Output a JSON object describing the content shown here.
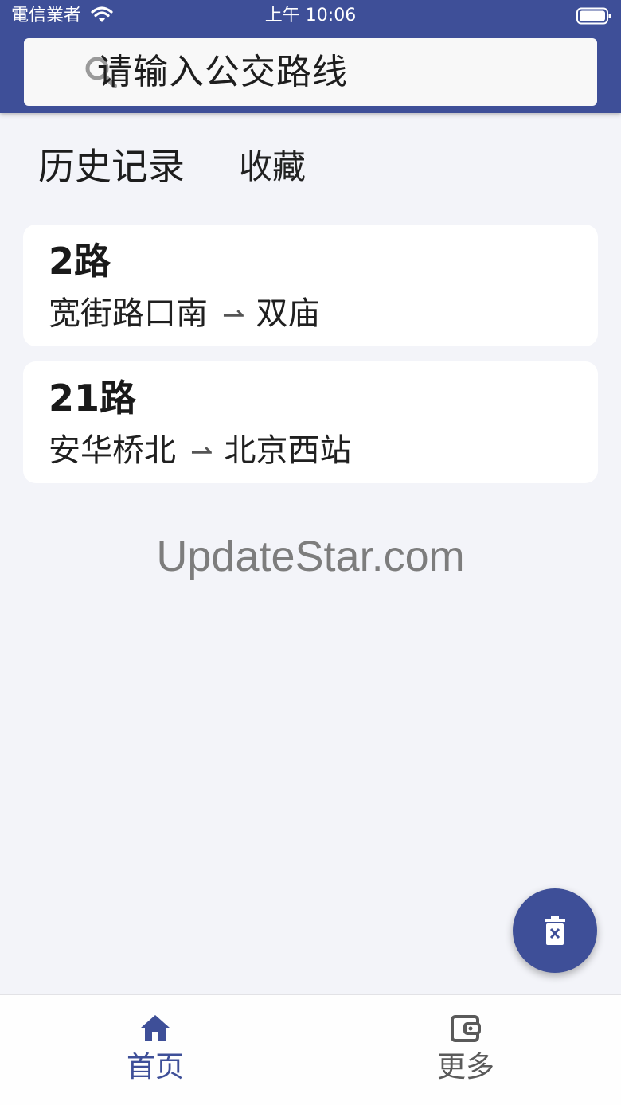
{
  "status_bar": {
    "carrier": "電信業者",
    "time": "上午 10:06"
  },
  "search": {
    "placeholder": "请输入公交路线",
    "icon": "search-icon"
  },
  "tabs": {
    "history": "历史记录",
    "favorites": "收藏"
  },
  "routes": [
    {
      "name": "2路",
      "from": "宽街路口南",
      "to": "双庙"
    },
    {
      "name": "21路",
      "from": "安华桥北",
      "to": "北京西站"
    }
  ],
  "watermark": "UpdateStar.com",
  "fab": {
    "icon": "delete-icon"
  },
  "bottom_nav": [
    {
      "label": "首页",
      "icon": "home-icon",
      "active": true
    },
    {
      "label": "更多",
      "icon": "wallet-icon",
      "active": false
    }
  ],
  "colors": {
    "primary": "#3e4f98",
    "background": "#f3f4f9",
    "card": "#ffffff"
  }
}
